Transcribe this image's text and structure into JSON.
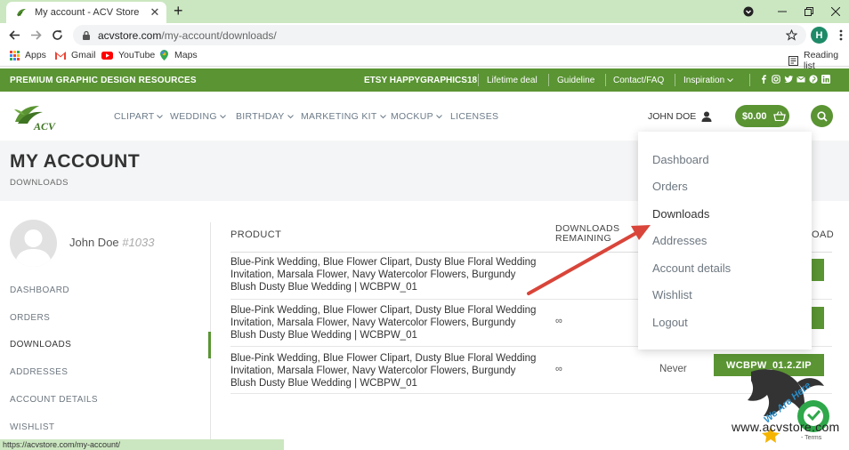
{
  "browser": {
    "tab_title": "My account - ACV Store",
    "url_host": "acvstore.com",
    "url_path": "/my-account/downloads/",
    "profile_initial": "H",
    "status_url": "https://acvstore.com/my-account/",
    "bookmarks": [
      "Apps",
      "Gmail",
      "YouTube",
      "Maps"
    ],
    "reading_list": "Reading list"
  },
  "topbar": {
    "promo": "PREMIUM GRAPHIC DESIGN RESOURCES",
    "etsy": "ETSY HAPPYGRAPHICS18",
    "links": [
      "Lifetime deal",
      "Guideline",
      "Contact/FAQ",
      "Inspiration"
    ]
  },
  "header": {
    "menu": [
      "CLIPART",
      "WEDDING",
      "BIRTHDAY",
      "MARKETING KIT",
      "MOCKUP",
      "LICENSES"
    ],
    "user_name": "JOHN DOE",
    "cart_total": "$0.00"
  },
  "page": {
    "title": "MY ACCOUNT",
    "breadcrumb": "DOWNLOADS"
  },
  "sidebar": {
    "display_name": "John Doe",
    "user_id": "#1033",
    "items": [
      "DASHBOARD",
      "ORDERS",
      "DOWNLOADS",
      "ADDRESSES",
      "ACCOUNT DETAILS",
      "WISHLIST"
    ]
  },
  "table": {
    "headers": {
      "product": "PRODUCT",
      "remaining_1": "DOWNLOADS",
      "remaining_2": "REMAINING",
      "download": "OAD"
    },
    "rows": [
      {
        "product": "Blue-Pink Wedding, Blue Flower Clipart, Dusty Blue Floral Wedding Invitation, Marsala Flower, Navy Watercolor Flowers, Burgundy Blush Dusty Blue Wedding | WCBPW_01",
        "remaining": "",
        "expires": "",
        "button": ""
      },
      {
        "product": "Blue-Pink Wedding, Blue Flower Clipart, Dusty Blue Floral Wedding Invitation, Marsala Flower, Navy Watercolor Flowers, Burgundy Blush Dusty Blue Wedding | WCBPW_01",
        "remaining": "∞",
        "expires": "",
        "button": ""
      },
      {
        "product": "Blue-Pink Wedding, Blue Flower Clipart, Dusty Blue Floral Wedding Invitation, Marsala Flower, Navy Watercolor Flowers, Burgundy Blush Dusty Blue Wedding | WCBPW_01",
        "remaining": "∞",
        "expires": "Never",
        "button": "WCBPW_01.2.ZIP"
      }
    ]
  },
  "account_dropdown": {
    "items": [
      "Dashboard",
      "Orders",
      "Downloads",
      "Addresses",
      "Account details",
      "Wishlist",
      "Logout"
    ]
  },
  "watermark": {
    "text": "www.acvstore.com",
    "badge_text": "We Are Here",
    "recaptcha_text": "- Terms"
  },
  "colors": {
    "brand_green": "#5a9433",
    "browser_green": "#cbe7c1",
    "arrow_red": "#d9453a"
  }
}
